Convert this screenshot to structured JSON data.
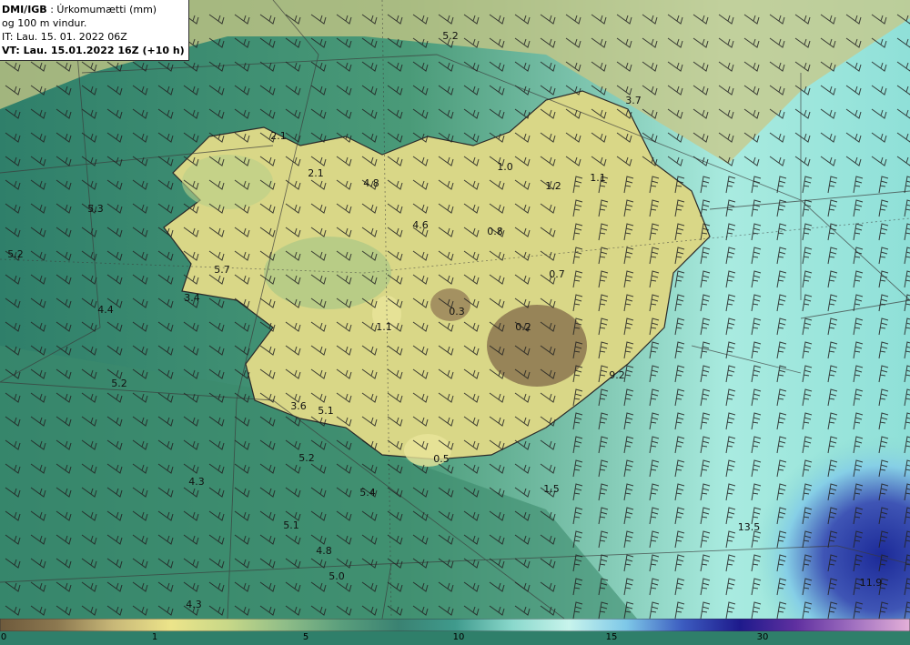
{
  "header": {
    "source": "DMI/IGB",
    "field": "Úrkomumætti (mm)",
    "field2": "og 100 m vindur.",
    "init_time": "IT: Lau. 15. 01. 2022 06Z",
    "valid_time": "VT: Lau. 15.01.2022 16Z (+10 h)"
  },
  "value_labels": [
    "5.2",
    "3.7",
    "2.1",
    "2.1",
    "4.8",
    "1.0",
    "1.2",
    "1.1",
    "5.3",
    "4.6",
    "0.8",
    "5.2",
    "5.7",
    "0.7",
    "3.4",
    "4.4",
    "0.3",
    "1.1",
    "0.2",
    "9.2",
    "5.2",
    "3.6",
    "5.1",
    "5.2",
    "0.5",
    "4.3",
    "5.4",
    "1.5",
    "5.1",
    "13.5",
    "4.8",
    "5.0",
    "11.9",
    "4.3"
  ],
  "colorbar": {
    "ticks": [
      "0",
      "1",
      "5",
      "10",
      "15",
      "30"
    ],
    "colors": [
      "#6e5a3c",
      "#8c7850",
      "#c8b878",
      "#ece48a",
      "#c8d888",
      "#8fbd88",
      "#5a9e7c",
      "#3a8272",
      "#3f9a8c",
      "#8ad8cc",
      "#c8f4ec",
      "#7ec8e8",
      "#3c5cc0",
      "#1e1a8c",
      "#6030a0",
      "#a070c0",
      "#e4b0d8"
    ]
  }
}
